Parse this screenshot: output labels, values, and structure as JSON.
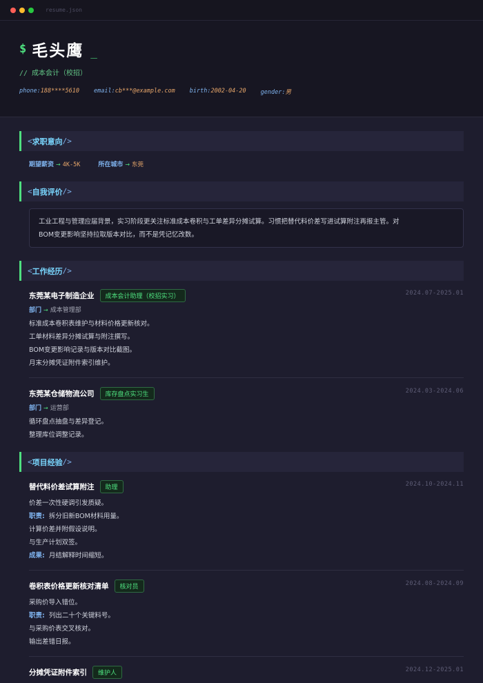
{
  "window": {
    "title": "resume.json"
  },
  "header": {
    "prompt": "$",
    "name": "毛头鹰",
    "cursor": "_",
    "role": "// 成本会计（校招）",
    "contacts": [
      {
        "key": "phone:",
        "value": "188****5610"
      },
      {
        "key": "email:",
        "value": "cb***@example.com"
      },
      {
        "key": "birth:",
        "value": "2002-04-20"
      },
      {
        "key": "gender:",
        "value": "男"
      }
    ]
  },
  "sections": {
    "open_bracket": "<",
    "close_bracket": "/>",
    "intent_title": "求职意向",
    "summary_title": "自我评价",
    "work_title": "工作经历",
    "project_title": "项目经验"
  },
  "intent": {
    "arrow": "→",
    "salary_label": "期望薪资",
    "salary_value": "4K-5K",
    "city_label": "所在城市",
    "city_value": "东莞"
  },
  "summary": {
    "lines": [
      "工业工程与管理应届背景，实习阶段更关注标准成本卷积与工单差异分摊试算。习惯把替代料价差写进试算附注再报主管。对",
      "BOM变更影响坚持拉取版本对比，而不是凭记忆改数。"
    ]
  },
  "work": [
    {
      "company": "东莞某电子制造企业",
      "tag": "成本会计助理（校招实习）",
      "date": "2024.07-2025.01",
      "dept_label": "部门",
      "dept_arrow": "→",
      "dept_value": "成本管理部",
      "bullets": [
        "标准成本卷积表维护与材料价格更新核对。",
        "工单材料差异分摊试算与附注撰写。",
        "BOM变更影响记录与版本对比截图。",
        "月末分摊凭证附件索引维护。"
      ]
    },
    {
      "company": "东莞某仓储物流公司",
      "tag": "库存盘点实习生",
      "date": "2024.03-2024.06",
      "dept_label": "部门",
      "dept_arrow": "→",
      "dept_value": "运营部",
      "bullets": [
        "循环盘点抽盘与差异登记。",
        "整理库位调整记录。"
      ]
    }
  ],
  "projects": [
    {
      "name": "替代料价差试算附注",
      "tag": "助理",
      "date": "2024.10-2024.11",
      "lines": [
        {
          "label": "",
          "text": "价差一次性硬调引发质疑。"
        },
        {
          "label": "职责:",
          "text": "拆分旧新BOM材料用量。"
        },
        {
          "label": "",
          "text": "计算价差并附假设说明。"
        },
        {
          "label": "",
          "text": "与生产计划双签。"
        },
        {
          "label": "成果:",
          "text": "月结解释时间缩短。"
        }
      ]
    },
    {
      "name": "卷积表价格更新核对清单",
      "tag": "核对员",
      "date": "2024.08-2024.09",
      "lines": [
        {
          "label": "",
          "text": "采购价导入错位。"
        },
        {
          "label": "职责:",
          "text": "列出二十个关键料号。"
        },
        {
          "label": "",
          "text": "与采购价表交叉核对。"
        },
        {
          "label": "",
          "text": "输出差错日报。"
        }
      ]
    },
    {
      "name": "分摊凭证附件索引",
      "tag": "维护人",
      "date": "2024.12-2025.01",
      "lines": []
    }
  ],
  "colors": {
    "background": "#1e1d2e",
    "accent_green": "#4ee07f",
    "accent_blue": "#7ad7ff",
    "accent_orange": "#e7a66a"
  }
}
